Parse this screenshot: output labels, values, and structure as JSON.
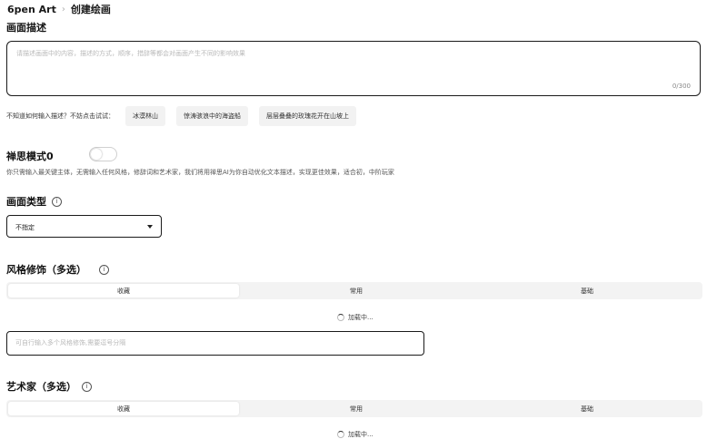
{
  "breadcrumb": {
    "root": "6pen Art",
    "separator": "›",
    "current": "创建绘画"
  },
  "description": {
    "title": "画面描述",
    "placeholder": "请描述画面中的内容，描述的方式，顺序，措辞等都会对画面产生不同的影响效果",
    "counter": "0/300"
  },
  "hints": {
    "label": "不知道如何输入描述？不妨点击试试：",
    "chips": [
      "冰漠林山",
      "惊涛骇浪中的海盗船",
      "层层叠叠的玫瑰花开在山坡上"
    ]
  },
  "zen_mode": {
    "title": "禅思模式0",
    "enabled": false,
    "description": "你只需输入最关键主体，无需输入任何风格，修辞词和艺术家，我们将用禅思AI为你自动优化文本描述，实现更佳效果，适合初，中阶玩家"
  },
  "picture_type": {
    "title": "画面类型",
    "info": "i",
    "selected": "不指定"
  },
  "style": {
    "title": "风格修饰（多选）",
    "info": "i",
    "tabs": [
      "收藏",
      "常用",
      "基础"
    ],
    "loading": "加载中...",
    "input_placeholder": "可自行输入多个风格修饰,需要逗号分隔"
  },
  "artist": {
    "title": "艺术家（多选）",
    "info": "i",
    "tabs": [
      "收藏",
      "常用",
      "基础"
    ],
    "loading": "加载中..."
  }
}
